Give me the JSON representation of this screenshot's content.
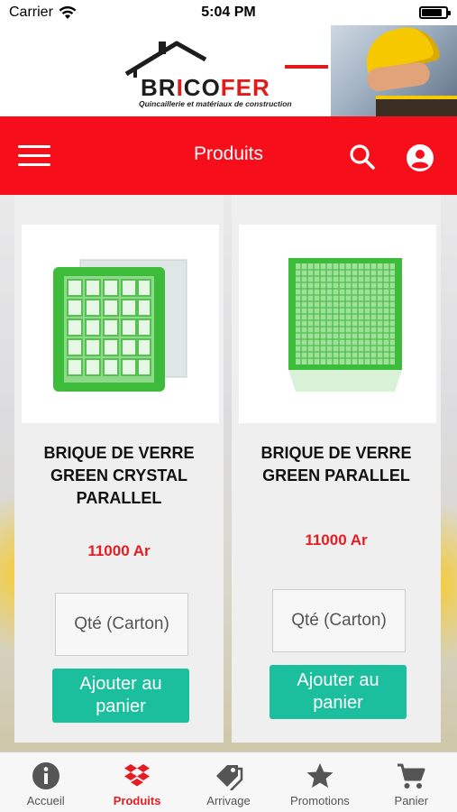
{
  "status_bar": {
    "carrier": "Carrier",
    "time": "5:04 PM",
    "battery_level": 0.85
  },
  "banner": {
    "logo_text_start": "BR",
    "logo_text_accent": "I",
    "logo_text_mid": "CO",
    "logo_text_end": "FER",
    "tagline": "Quincaillerie et matériaux de construction"
  },
  "header": {
    "title": "Produits",
    "menu_icon": "hamburger-icon",
    "search_icon": "search-icon",
    "account_icon": "account-icon"
  },
  "products": [
    {
      "name": "BRIQUE DE VERRE GREEN CRYSTAL PARALLEL",
      "price": "11000 Ar",
      "qty_placeholder": "Qté (Carton)",
      "add_label": "Ajouter au panier"
    },
    {
      "name": "BRIQUE DE VERRE GREEN PARALLEL",
      "price": "11000 Ar",
      "qty_placeholder": "Qté (Carton)",
      "add_label": "Ajouter au panier"
    }
  ],
  "tabs": [
    {
      "label": "Accueil",
      "icon": "info-icon",
      "active": false
    },
    {
      "label": "Produits",
      "icon": "dropbox-icon",
      "active": true
    },
    {
      "label": "Arrivage",
      "icon": "tags-icon",
      "active": false
    },
    {
      "label": "Promotions",
      "icon": "star-icon",
      "active": false
    },
    {
      "label": "Panier",
      "icon": "cart-icon",
      "active": false
    }
  ],
  "colors": {
    "header_red": "#f60e1b",
    "price_red": "#e51d23",
    "button_teal": "#1bbf9d",
    "glass_green": "#3dbb3a"
  }
}
